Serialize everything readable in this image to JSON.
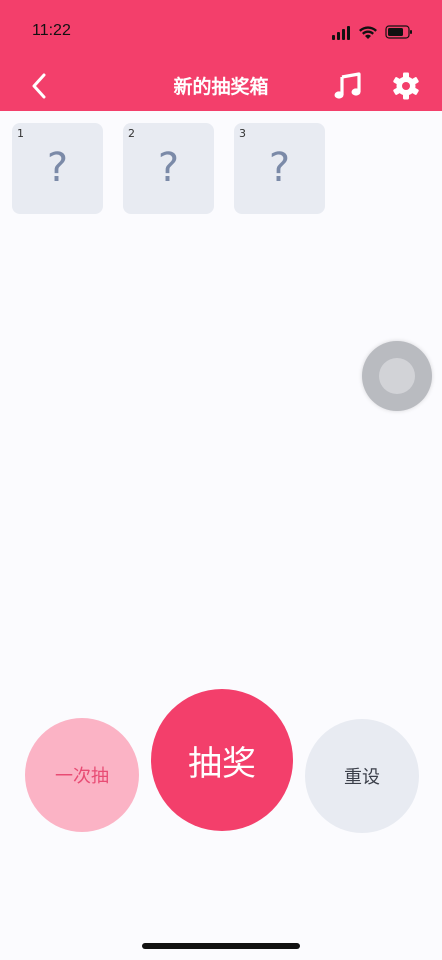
{
  "status_bar": {
    "time": "11:22"
  },
  "header": {
    "title": "新的抽奖箱",
    "back_icon": "chevron-left-icon",
    "music_icon": "music-note-icon",
    "settings_icon": "gear-icon",
    "accent_color": "#f33f6b"
  },
  "slots": [
    {
      "number": "1",
      "mark": "?"
    },
    {
      "number": "2",
      "mark": "?"
    },
    {
      "number": "3",
      "mark": "?"
    }
  ],
  "actions": {
    "once_label": "一次抽",
    "draw_label": "抽奖",
    "reset_label": "重设"
  },
  "colors": {
    "primary": "#f33f6b",
    "secondary": "#fbb3c5",
    "neutral": "#e8ebf2",
    "slot_mark": "#7b8aa8"
  }
}
